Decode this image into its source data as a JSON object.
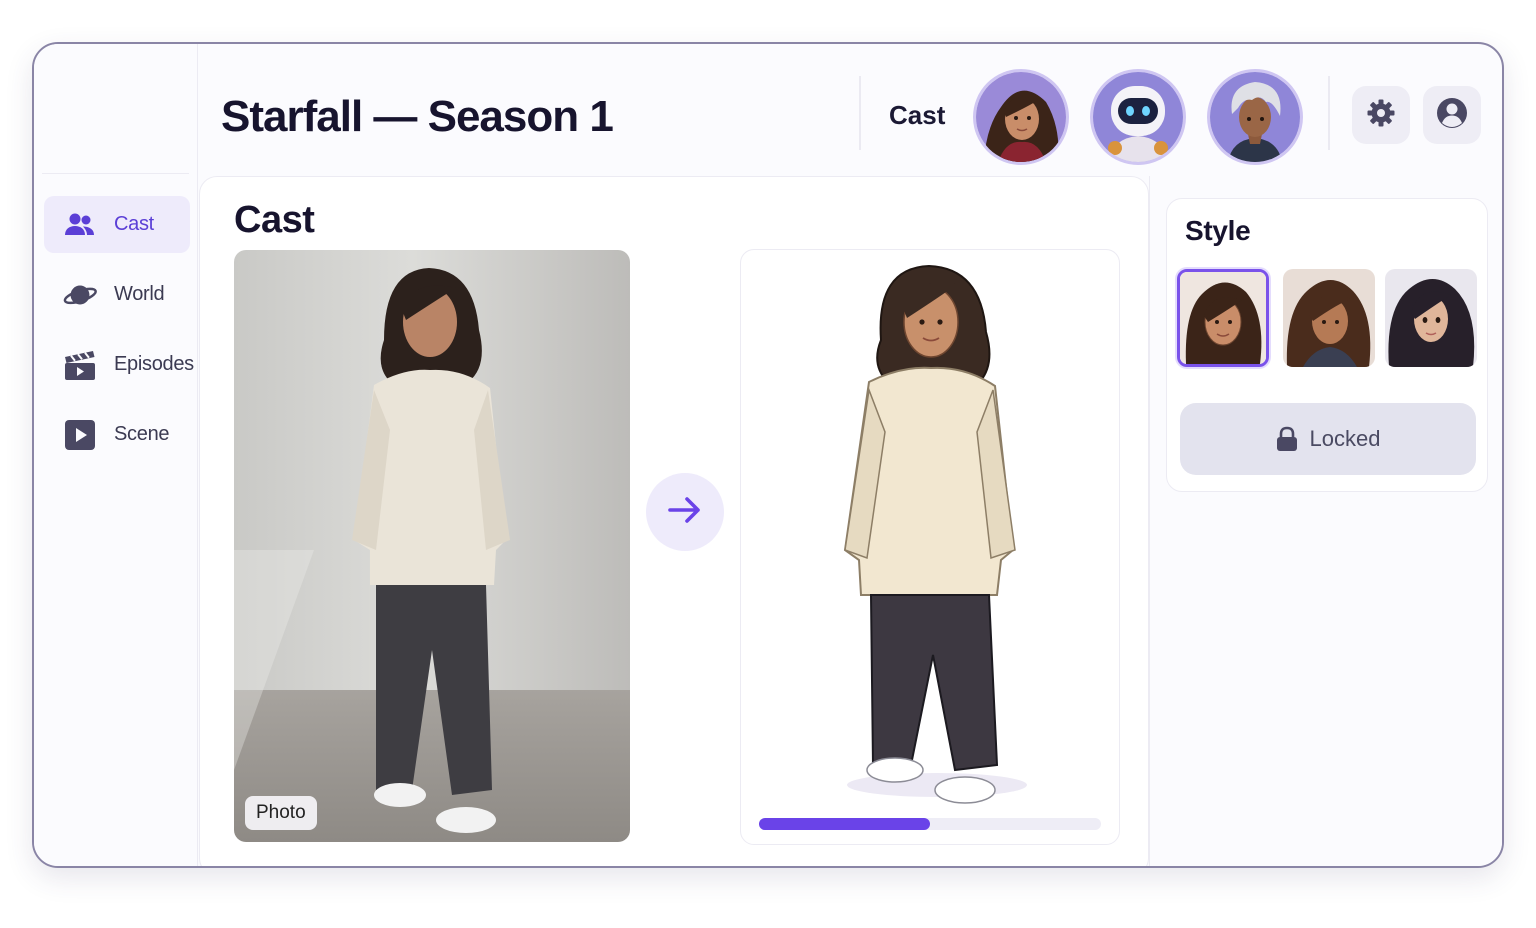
{
  "header": {
    "title": "Starfall — Season 1",
    "cast_label": "Cast",
    "avatars": [
      {
        "name": "woman-avatar"
      },
      {
        "name": "robot-avatar"
      },
      {
        "name": "silver-hair-avatar"
      }
    ],
    "icons": [
      "gear-icon",
      "user-circle-icon"
    ]
  },
  "sidebar": {
    "items": [
      {
        "label": "Cast",
        "icon": "people-icon",
        "active": true
      },
      {
        "label": "World",
        "icon": "planet-icon",
        "active": false
      },
      {
        "label": "Episodes",
        "icon": "clapperboard-icon",
        "active": false
      },
      {
        "label": "Scene",
        "icon": "play-icon",
        "active": false
      }
    ]
  },
  "main": {
    "title": "Cast",
    "photo_tag": "Photo",
    "arrow_icon": "arrow-right-icon",
    "progress": 0.5
  },
  "style_panel": {
    "title": "Style",
    "thumbnails": [
      "style-thumb-1",
      "style-thumb-2",
      "style-thumb-3"
    ],
    "selected_index": 0,
    "locked_label": "Locked",
    "locked_icon": "lock-icon"
  },
  "colors": {
    "accent": "#6a43e8",
    "active_bg": "#eeebfb",
    "title": "#17142e"
  }
}
